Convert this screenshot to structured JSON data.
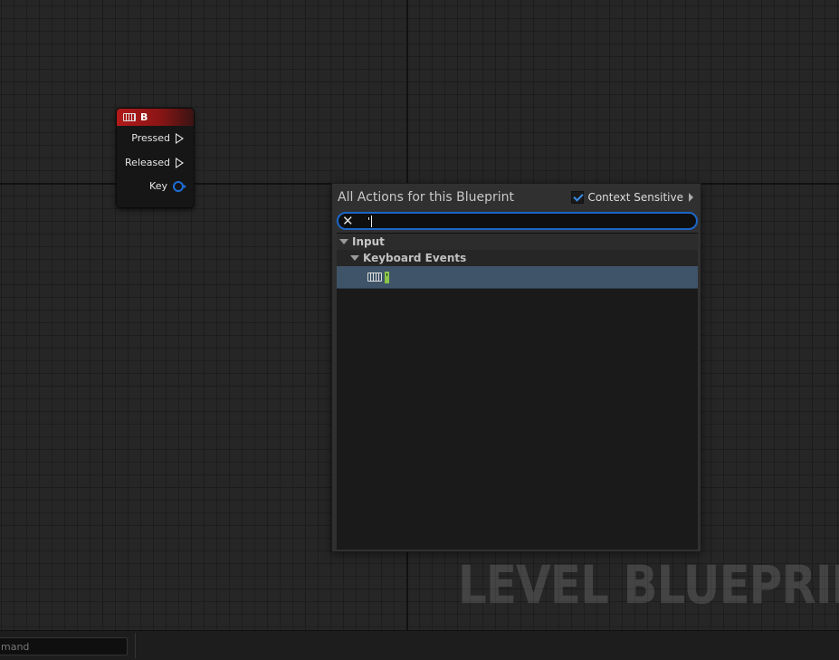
{
  "node": {
    "title": "B",
    "pins": {
      "pressed": "Pressed",
      "released": "Released",
      "key": "Key"
    }
  },
  "action_menu": {
    "title": "All Actions for this Blueprint",
    "context_sensitive_label": "Context Sensitive",
    "context_sensitive_checked": true,
    "search_value": "'",
    "categories": [
      {
        "label": "Input",
        "subcategory": "Keyboard Events",
        "item_label": "'"
      }
    ]
  },
  "watermark": "LEVEL BLUEPRIN",
  "bottom_bar": {
    "command_placeholder": "mand"
  },
  "colors": {
    "accent": "#1c66c9",
    "node_header": "#b21a1a",
    "selected_row": "#3f5468",
    "highlight": "#8ac54a"
  }
}
